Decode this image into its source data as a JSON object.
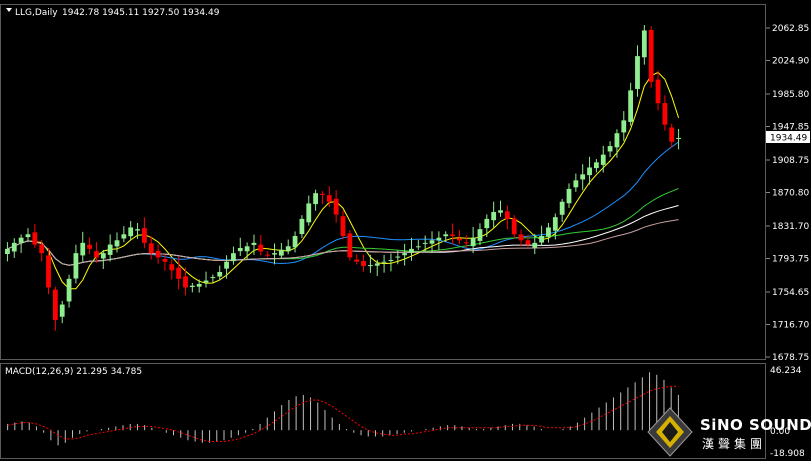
{
  "header": {
    "symbol_label": "LLG,Daily",
    "ohlc_label": "1942.78 1945.11 1927.50 1934.49"
  },
  "macd_panel": {
    "label": "MACD(12,26,9) 21.295 34.785",
    "scale_top": "46.234",
    "scale_mid": "0.00",
    "scale_bottom": "-18.908"
  },
  "price_axis": {
    "labels": [
      "2062.85",
      "2024.90",
      "1985.80",
      "1947.85",
      "1908.75",
      "1870.80",
      "1831.70",
      "1793.75",
      "1754.65",
      "1716.70",
      "1678.75"
    ],
    "current_price": "1934.49"
  },
  "logo": {
    "title": "SiNO SOUND",
    "subtitle": "漢聲集團"
  },
  "colors": {
    "background": "#000000",
    "bull_candle": "#90ee90",
    "bear_candle": "#ff0000",
    "ma_fast": "#ffff00",
    "ma_mid": "#1e90ff",
    "ma_slow1": "#32cd32",
    "ma_slow2": "#ffffff",
    "ma_slow3": "#c8a0a0",
    "macd_hist": "#c0c0c0",
    "macd_signal": "#ff0000"
  },
  "chart_data": {
    "type": "candlestick",
    "symbol": "LLG",
    "timeframe": "Daily",
    "ylim": [
      1678.75,
      2062.85
    ],
    "current_close": 1934.49,
    "close_path": [
      1805,
      1812,
      1818,
      1822,
      1810,
      1800,
      1760,
      1722,
      1740,
      1770,
      1800,
      1812,
      1805,
      1795,
      1800,
      1810,
      1815,
      1822,
      1830,
      1828,
      1812,
      1800,
      1795,
      1790,
      1780,
      1770,
      1760,
      1762,
      1764,
      1768,
      1772,
      1778,
      1790,
      1800,
      1806,
      1808,
      1812,
      1802,
      1798,
      1800,
      1804,
      1808,
      1820,
      1840,
      1858,
      1870,
      1868,
      1860,
      1845,
      1820,
      1795,
      1790,
      1785,
      1786,
      1788,
      1790,
      1792,
      1796,
      1800,
      1805,
      1808,
      1812,
      1815,
      1818,
      1822,
      1820,
      1815,
      1812,
      1818,
      1828,
      1840,
      1848,
      1850,
      1840,
      1822,
      1815,
      1810,
      1812,
      1820,
      1830,
      1842,
      1860,
      1875,
      1885,
      1892,
      1900,
      1906,
      1915,
      1925,
      1940,
      1955,
      1990,
      2030,
      2060,
      2000,
      1975,
      1950,
      1930,
      1934.49
    ],
    "macd": {
      "hist_path": [
        5,
        6,
        7,
        6,
        3,
        -2,
        -8,
        -12,
        -10,
        -6,
        -3,
        -1,
        0,
        1,
        2,
        3,
        4,
        5,
        5,
        4,
        2,
        0,
        -2,
        -4,
        -6,
        -8,
        -9,
        -10,
        -10,
        -9,
        -8,
        -6,
        -4,
        -2,
        1,
        5,
        10,
        15,
        20,
        24,
        27,
        28,
        26,
        22,
        16,
        10,
        5,
        1,
        -2,
        -4,
        -5,
        -5,
        -5,
        -4,
        -3,
        -2,
        -1,
        0,
        1,
        2,
        3,
        4,
        4,
        3,
        2,
        1,
        1,
        2,
        3,
        4,
        5,
        5,
        4,
        3,
        1,
        0,
        0,
        1,
        3,
        6,
        10,
        14,
        18,
        22,
        26,
        30,
        34,
        38,
        42,
        46,
        44,
        40,
        34,
        28
      ],
      "signal_path": [
        4,
        5,
        6,
        6,
        5,
        3,
        0,
        -4,
        -7,
        -7,
        -6,
        -4,
        -3,
        -2,
        -1,
        0,
        1,
        2,
        3,
        3,
        3,
        2,
        1,
        0,
        -2,
        -4,
        -6,
        -8,
        -9,
        -9,
        -9,
        -8,
        -7,
        -5,
        -3,
        0,
        3,
        7,
        11,
        15,
        19,
        22,
        24,
        24,
        22,
        19,
        15,
        11,
        7,
        3,
        0,
        -2,
        -3,
        -4,
        -4,
        -3,
        -3,
        -2,
        -1,
        0,
        1,
        2,
        2,
        2,
        2,
        2,
        2,
        2,
        2,
        3,
        3,
        4,
        4,
        4,
        3,
        2,
        2,
        2,
        2,
        3,
        5,
        7,
        10,
        13,
        16,
        19,
        22,
        25,
        28,
        31,
        33,
        34,
        34.785,
        34.785
      ]
    }
  }
}
